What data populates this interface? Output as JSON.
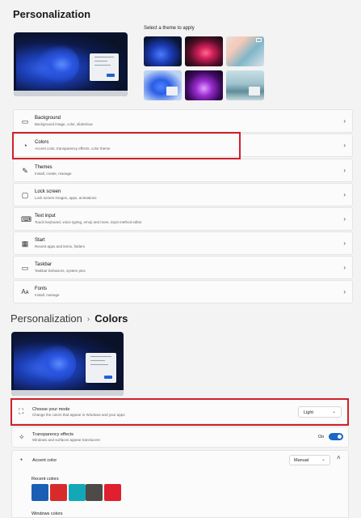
{
  "personalization": {
    "title": "Personalization",
    "theme_label": "Select a theme to apply",
    "rows": [
      {
        "title": "Background",
        "subtitle": "Background image, color, slideshow",
        "icon": "image-icon"
      },
      {
        "title": "Colors",
        "subtitle": "Accent color, transparency effects, color theme",
        "icon": "palette-icon"
      },
      {
        "title": "Themes",
        "subtitle": "Install, create, manage",
        "icon": "brush-icon"
      },
      {
        "title": "Lock screen",
        "subtitle": "Lock screen images, apps, animations",
        "icon": "lock-screen-icon"
      },
      {
        "title": "Text input",
        "subtitle": "Touch keyboard, voice typing, emoji and more, input method editor",
        "icon": "keyboard-icon"
      },
      {
        "title": "Start",
        "subtitle": "Recent apps and items, folders",
        "icon": "start-icon"
      },
      {
        "title": "Taskbar",
        "subtitle": "Taskbar behaviors, system pins",
        "icon": "taskbar-icon"
      },
      {
        "title": "Fonts",
        "subtitle": "Install, manage",
        "icon": "fonts-icon"
      }
    ]
  },
  "colors_page": {
    "breadcrumb_parent": "Personalization",
    "breadcrumb_separator": "›",
    "breadcrumb_current": "Colors",
    "mode": {
      "title": "Choose your mode",
      "subtitle": "Change the colors that appear in Windows and your apps",
      "value": "Light"
    },
    "transparency": {
      "title": "Transparency effects",
      "subtitle": "Windows and surfaces appear translucent",
      "state": "On"
    },
    "accent": {
      "title": "Accent color",
      "value": "Manual"
    },
    "recent_colors_label": "Recent colors",
    "recent_colors": [
      "#1a5fb4",
      "#d72b2b",
      "#13a8b8",
      "#4d4a47",
      "#e0202f"
    ],
    "windows_colors_label": "Windows colors"
  },
  "colors": {
    "accent": "#1a66c9",
    "highlight": "#d0202a"
  }
}
